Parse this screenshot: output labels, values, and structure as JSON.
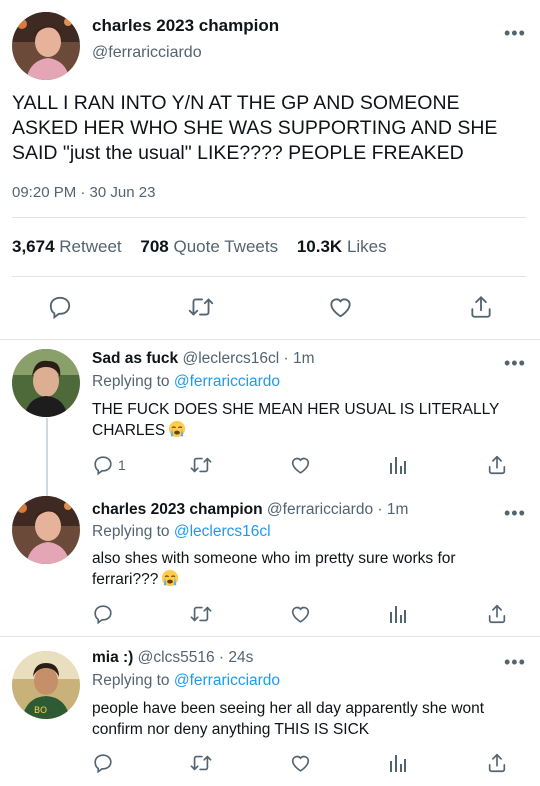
{
  "main_tweet": {
    "display_name": "charles 2023 champion",
    "handle": "@ferraricciardo",
    "text": "YALL I RAN INTO Y/N AT THE GP AND SOMEONE ASKED HER WHO SHE WAS SUPPORTING AND SHE SAID \"just the usual\" LIKE???? PEOPLE FREAKED",
    "time": "09:20 PM · 30 Jun 23",
    "stats": {
      "retweets": "3,674",
      "retweets_label": "Retweet",
      "quotes": "708",
      "quotes_label": "Quote Tweets",
      "likes": "10.3K",
      "likes_label": "Likes"
    }
  },
  "replies": [
    {
      "display_name": "Sad as fuck",
      "meta": "@leclercs16cl · 1m",
      "replying_label": "Replying to",
      "replying_to": "@ferraricciardo",
      "text": "THE FUCK DOES SHE MEAN HER USUAL IS LITERALLY CHARLES",
      "reply_count": "1"
    },
    {
      "display_name": "charles 2023 champion",
      "meta": "@ferraricciardo · 1m",
      "replying_label": "Replying to",
      "replying_to": "@leclercs16cl",
      "text": "also shes with someone who im pretty sure works for ferrari???",
      "reply_count": ""
    },
    {
      "display_name": "mia :)",
      "meta": "@clcs5516 · 24s",
      "replying_label": "Replying to",
      "replying_to": "@ferraricciardo",
      "text": "people have been seeing her all day apparently she wont confirm nor deny anything THIS IS SICK",
      "reply_count": ""
    }
  ],
  "icons": {
    "more": "more-icon",
    "reply": "reply-icon",
    "retweet": "retweet-icon",
    "like": "heart-icon",
    "analytics": "analytics-icon",
    "share": "share-icon",
    "emoji": "loudly-crying-face-emoji"
  },
  "colors": {
    "text": "#0f1419",
    "secondary": "#536471",
    "link": "#1d9bf0",
    "divider": "#dfe3e7"
  }
}
